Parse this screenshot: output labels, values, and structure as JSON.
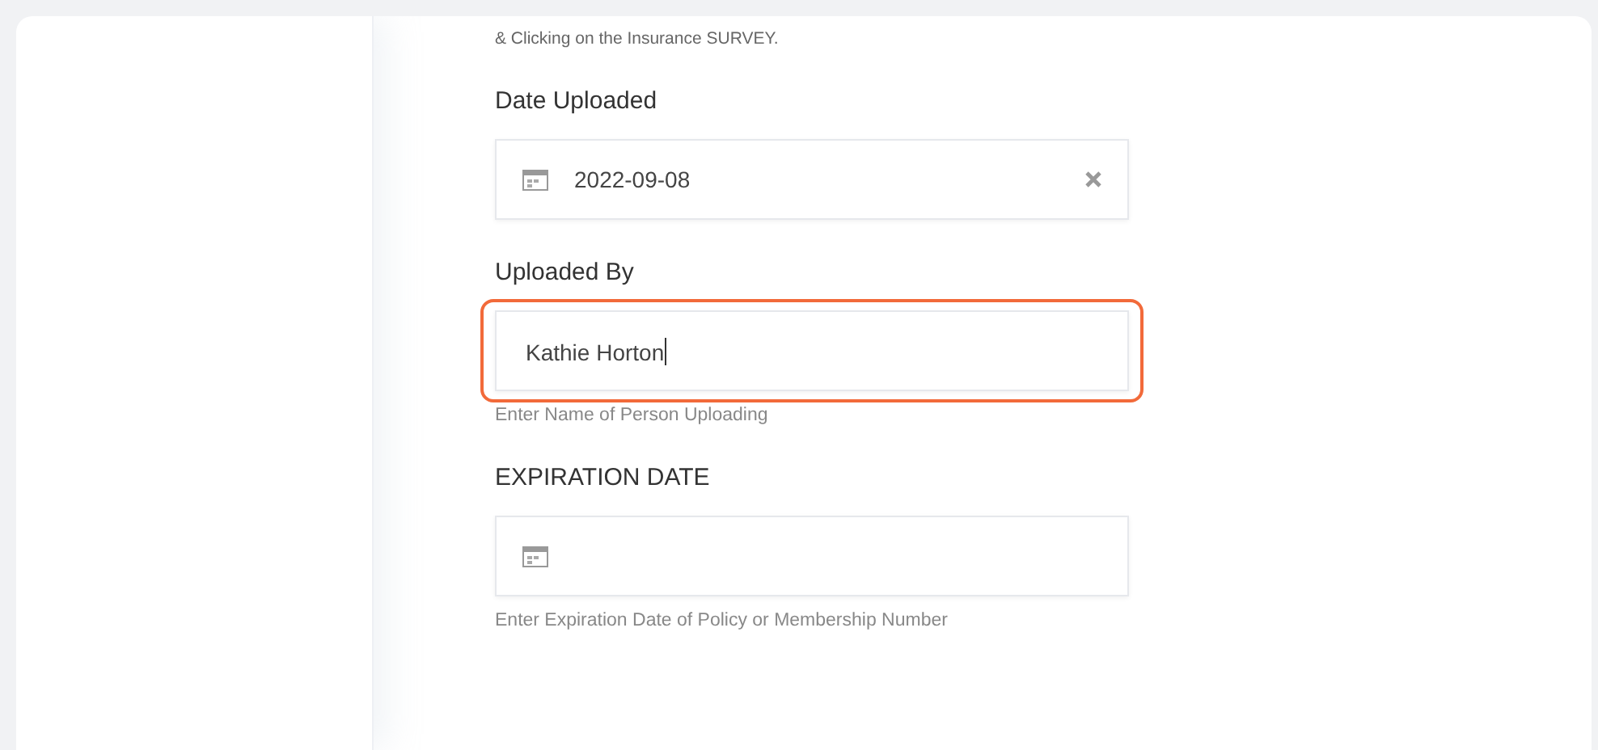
{
  "note": "& Clicking on the Insurance SURVEY.",
  "fields": [
    {
      "kind": "date",
      "label": "Date Uploaded",
      "value": "2022-09-08",
      "clearable": true,
      "highlighted": false
    },
    {
      "kind": "text",
      "label": "Uploaded By",
      "value": "Kathie Horton",
      "help": "Enter Name of Person Uploading",
      "highlighted": true
    },
    {
      "kind": "date",
      "label": "EXPIRATION DATE",
      "help": "Enter Expiration Date of Policy or Membership Number",
      "highlighted": false
    }
  ]
}
